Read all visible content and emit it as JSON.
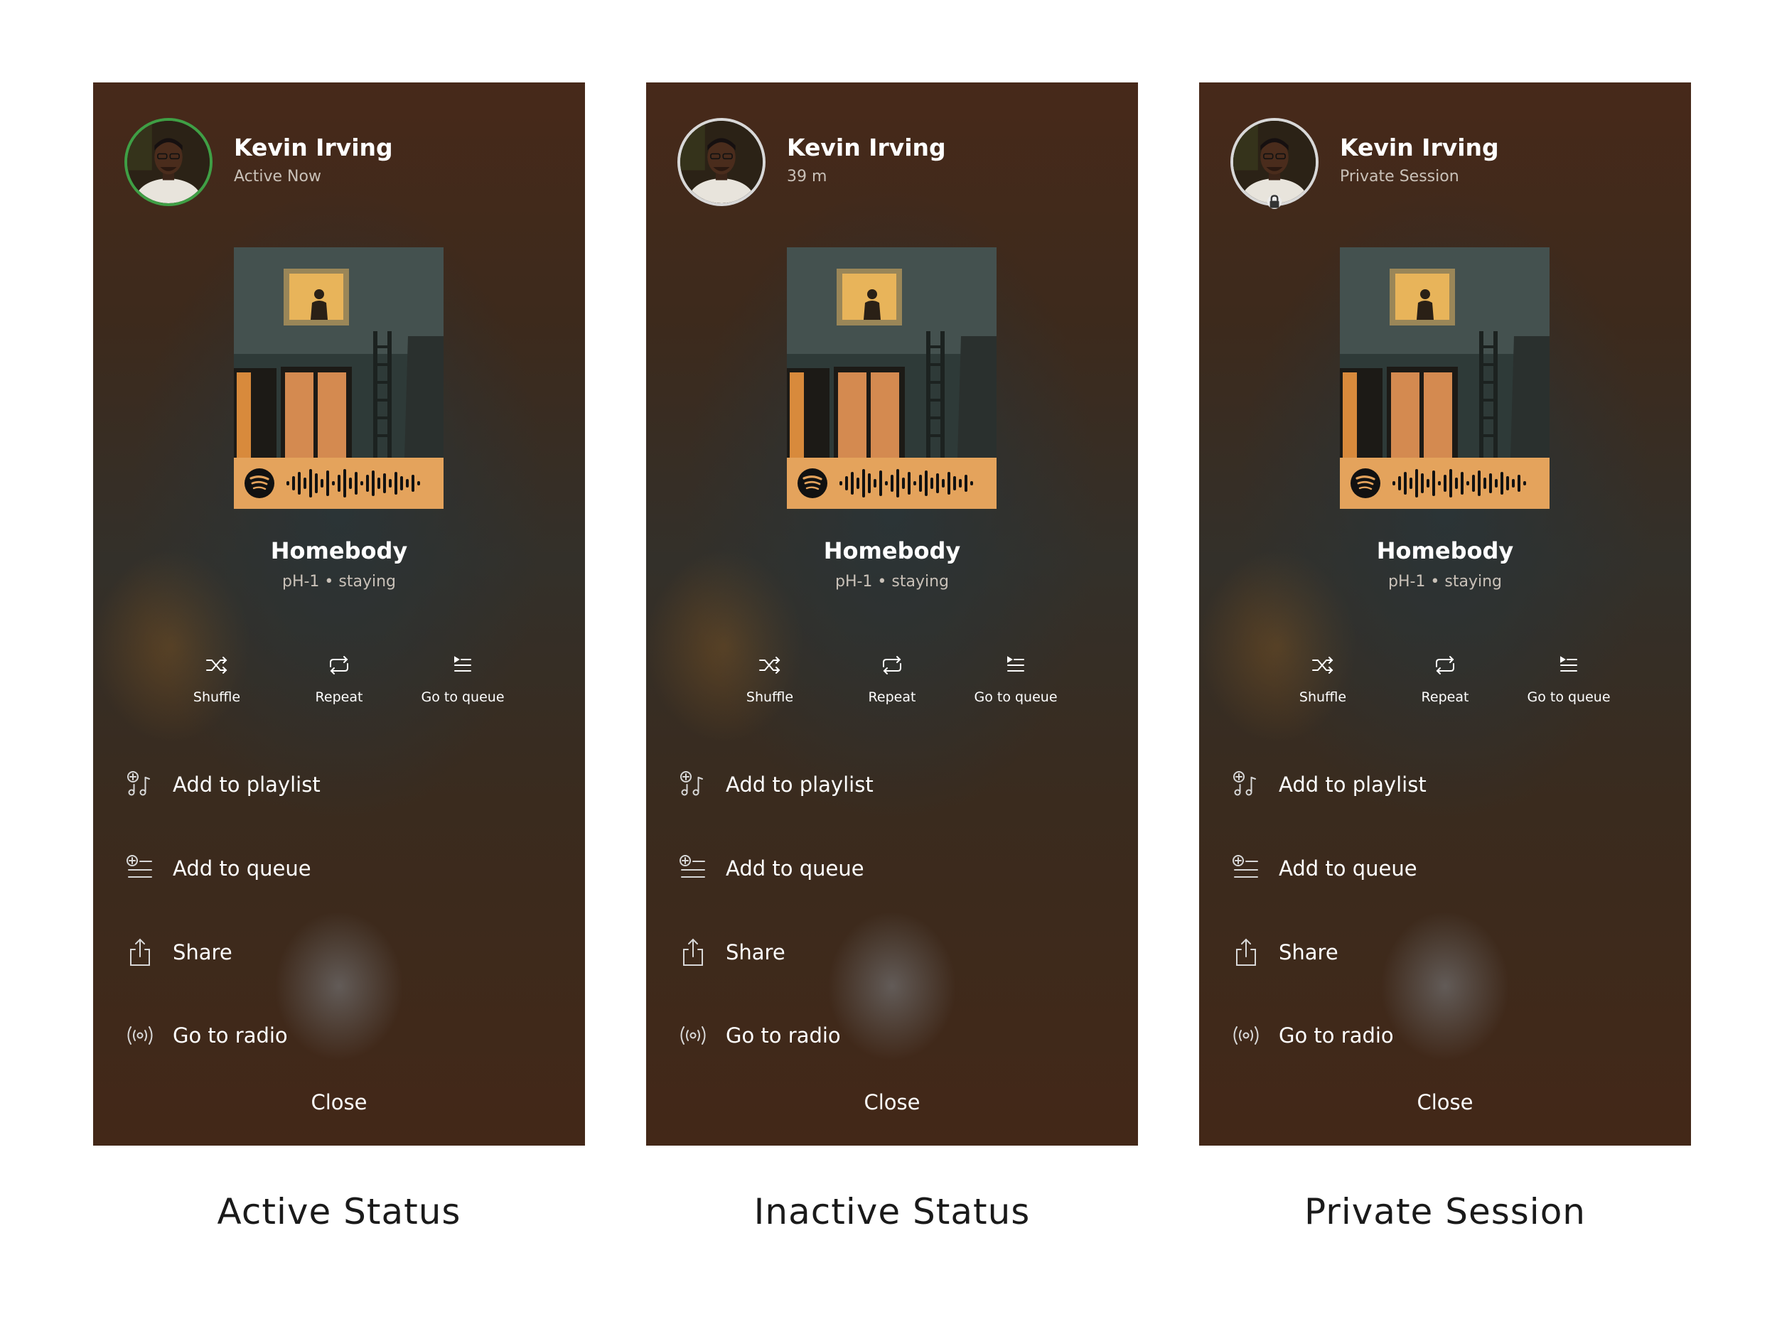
{
  "panels": [
    {
      "user": {
        "name": "Kevin Irving",
        "status": "Active Now",
        "indicator": "green-ring"
      },
      "track": {
        "title": "Homebody",
        "subtitle": "pH-1 • staying"
      },
      "controls": [
        {
          "label": "Shuffle",
          "icon": "shuffle-icon"
        },
        {
          "label": "Repeat",
          "icon": "repeat-icon"
        },
        {
          "label": "Go to queue",
          "icon": "queue-icon"
        }
      ],
      "menu": [
        {
          "label": "Add to playlist",
          "icon": "add-to-playlist-icon"
        },
        {
          "label": "Add to queue",
          "icon": "add-to-queue-icon"
        },
        {
          "label": "Share",
          "icon": "share-icon"
        },
        {
          "label": "Go to radio",
          "icon": "radio-icon"
        }
      ],
      "close_label": "Close",
      "caption": "Active Status"
    },
    {
      "user": {
        "name": "Kevin Irving",
        "status": "39 m",
        "indicator": "grey-ring"
      },
      "track": {
        "title": "Homebody",
        "subtitle": "pH-1 • staying"
      },
      "controls": [
        {
          "label": "Shuffle",
          "icon": "shuffle-icon"
        },
        {
          "label": "Repeat",
          "icon": "repeat-icon"
        },
        {
          "label": "Go to queue",
          "icon": "queue-icon"
        }
      ],
      "menu": [
        {
          "label": "Add to playlist",
          "icon": "add-to-playlist-icon"
        },
        {
          "label": "Add to queue",
          "icon": "add-to-queue-icon"
        },
        {
          "label": "Share",
          "icon": "share-icon"
        },
        {
          "label": "Go to radio",
          "icon": "radio-icon"
        }
      ],
      "close_label": "Close",
      "caption": "Inactive Status"
    },
    {
      "user": {
        "name": "Kevin Irving",
        "status": "Private Session",
        "indicator": "grey-ring-lock"
      },
      "track": {
        "title": "Homebody",
        "subtitle": "pH-1 • staying"
      },
      "controls": [
        {
          "label": "Shuffle",
          "icon": "shuffle-icon"
        },
        {
          "label": "Repeat",
          "icon": "repeat-icon"
        },
        {
          "label": "Go to queue",
          "icon": "queue-icon"
        }
      ],
      "menu": [
        {
          "label": "Add to playlist",
          "icon": "add-to-playlist-icon"
        },
        {
          "label": "Add to queue",
          "icon": "add-to-queue-icon"
        },
        {
          "label": "Share",
          "icon": "share-icon"
        },
        {
          "label": "Go to radio",
          "icon": "radio-icon"
        }
      ],
      "close_label": "Close",
      "caption": "Private Session"
    }
  ],
  "colors": {
    "panel_bg": "#3d2a1b",
    "active_ring": "#3f9f45",
    "inactive_ring": "#d8d8d8",
    "code_bar": "#e4a35c",
    "caption_text": "#1a1a1a"
  }
}
